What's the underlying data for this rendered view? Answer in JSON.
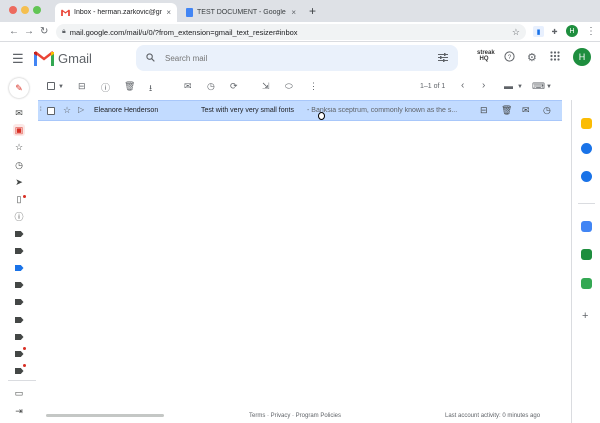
{
  "browser": {
    "tabs": [
      {
        "title": "Inbox - herman.zarkovic@gmai",
        "close": "×"
      },
      {
        "title": "TEST DOCUMENT - Google Do",
        "close": "×"
      }
    ],
    "new_tab": "+",
    "url": "mail.google.com/mail/u/0/?from_extension=gmail_text_resizer#inbox",
    "avatar_initial": "H"
  },
  "gmail": {
    "wordmark": "Gmail",
    "search_placeholder": "Search mail",
    "streak_logo": "streak HQ",
    "avatar_initial": "H"
  },
  "toolbar": {
    "pagination": "1–1 of 1"
  },
  "email": {
    "sender": "Eleanore Henderson",
    "subject": "Test with very very small fonts",
    "snippet": " - Banksia sceptrum, commonly known as the s..."
  },
  "footer": {
    "links": "Terms · Privacy · Program Policies",
    "last_activity": "Last account activity: 0 minutes ago"
  },
  "colors": {
    "selected_row": "#c2dbff",
    "search_bg": "#eaf1fb",
    "gmail_red": "#d93025",
    "avatar": "#1e8e3e"
  }
}
